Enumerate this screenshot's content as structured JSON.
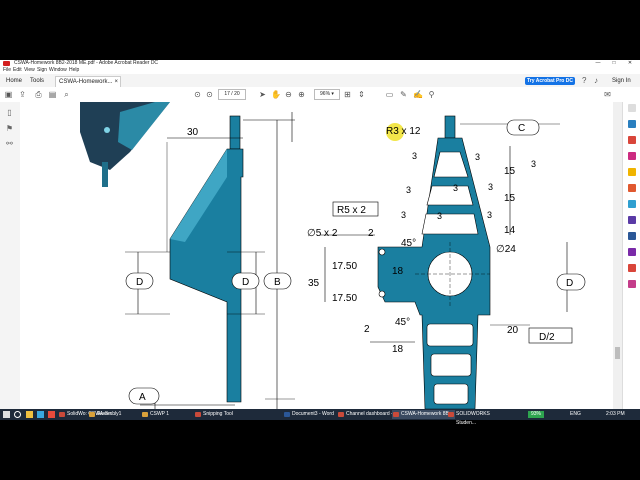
{
  "window": {
    "title": "CSWA-Homework 8B2-2018 ME.pdf - Adobe Acrobat Reader DC",
    "controls": [
      "—",
      "□",
      "✕"
    ]
  },
  "menu": [
    "File",
    "Edit",
    "View",
    "Sign",
    "Window",
    "Help"
  ],
  "tabs": [
    {
      "label": "Home"
    },
    {
      "label": "Tools"
    },
    {
      "label": "CSWA-Homework...",
      "close": "×"
    }
  ],
  "header": {
    "try_label": "Try Acrobat Pro DC",
    "signin_label": "Sign In"
  },
  "toolbar": {
    "page_current": "17",
    "page_total": "/ 20",
    "zoom": "96%"
  },
  "drawing": {
    "dims_left": [
      "30",
      "D",
      "D",
      "B",
      "A"
    ],
    "dims_right": [
      "R3 x 12",
      "C",
      "3",
      "3",
      "3",
      "3",
      "3",
      "3",
      "3",
      "3",
      "3",
      "15",
      "15",
      "14",
      "R5 x 2",
      "∅5 x 2",
      "2",
      "45°",
      "18",
      "17.50",
      "35",
      "17.50",
      "∅24",
      "D",
      "2",
      "45°",
      "18",
      "20",
      "D/2"
    ]
  },
  "taskbar": {
    "items": [
      {
        "label": "SolidWo: CSWA-Se...",
        "color": "#c94a3a"
      },
      {
        "label": "Assembly1",
        "color": "#d9a13b"
      },
      {
        "label": "CSWP 1",
        "color": "#d9a13b"
      },
      {
        "label": "Snipping Tool",
        "color": "#c94a3a"
      },
      {
        "label": "Document3 - Word",
        "color": "#2b5797"
      },
      {
        "label": "Channel dashboard -...",
        "color": "#c94a3a"
      },
      {
        "label": "CSWA-Homework 8B...",
        "color": "#c94a3a"
      },
      {
        "label": "SOLIDWORKS Studen...",
        "color": "#c94a3a"
      }
    ],
    "battery": "93%",
    "lang": "ENG",
    "time": "2:03 PM"
  }
}
